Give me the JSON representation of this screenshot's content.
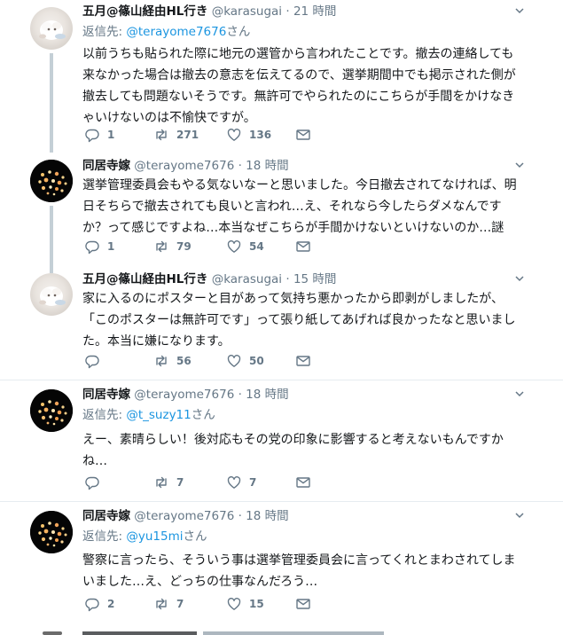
{
  "tweets": [
    {
      "name": "五月@篠山経由HL行き",
      "handle": "@karasugai",
      "dot": "·",
      "time": "21 時間",
      "reply_prefix": "返信先: ",
      "reply_mention": "@terayome7676",
      "reply_suffix": "さん",
      "body": [
        "以前うちも貼られた際に地元の選管から言われたことです。撤去の連絡しても",
        "来なかった場合は撤去の意志を伝えてるので、選挙期間中でも掲示された側が",
        "撤去しても問題ないそうです。無許可でやられたのにこちらが手間をかけなき",
        "ゃいけないのは不愉快ですが。"
      ],
      "replies": "1",
      "retweets": "271",
      "likes": "136"
    },
    {
      "name": "同居寺嫁",
      "handle": "@terayome7676",
      "dot": "·",
      "time": "18 時間",
      "body": [
        "選挙管理委員会もやる気ないなーと思いました。今日撤去されてなければ、明",
        "日そちらで撤去されても良いと言われ…え、それなら今したらダメなんです",
        "か？って感じですよね…本当なぜこちらが手間かけないといけないのか…謎"
      ],
      "replies": "1",
      "retweets": "79",
      "likes": "54"
    },
    {
      "name": "五月@篠山経由HL行き",
      "handle": "@karasugai",
      "dot": "·",
      "time": "15 時間",
      "body": [
        "家に入るのにポスターと目があって気持ち悪かったから即剥がしましたが、",
        "「このポスターは無許可です」って張り紙してあげれば良かったなと思いまし",
        "た。本当に嫌になります。"
      ],
      "replies": "",
      "retweets": "56",
      "likes": "50"
    },
    {
      "name": "同居寺嫁",
      "handle": "@terayome7676",
      "dot": "·",
      "time": "18 時間",
      "reply_prefix": "返信先: ",
      "reply_mention": "@t_suzy11",
      "reply_suffix": "さん",
      "body": [
        "えー、素晴らしい！後対応もその党の印象に影響すると考えないもんですか",
        "ね…"
      ],
      "replies": "",
      "retweets": "7",
      "likes": "7"
    },
    {
      "name": "同居寺嫁",
      "handle": "@terayome7676",
      "dot": "·",
      "time": "18 時間",
      "reply_prefix": "返信先: ",
      "reply_mention": "@yu15mi",
      "reply_suffix": "さん",
      "body": [
        "警察に言ったら、そういう事は選挙管理委員会に言ってくれとまわされてしま",
        "いました…え、どっちの仕事なんだろう…"
      ],
      "replies": "2",
      "retweets": "7",
      "likes": "15"
    }
  ],
  "colors": {
    "link": "#1b95e0",
    "muted": "#657786",
    "text": "#14171a",
    "thread": "#c4cfd6"
  }
}
